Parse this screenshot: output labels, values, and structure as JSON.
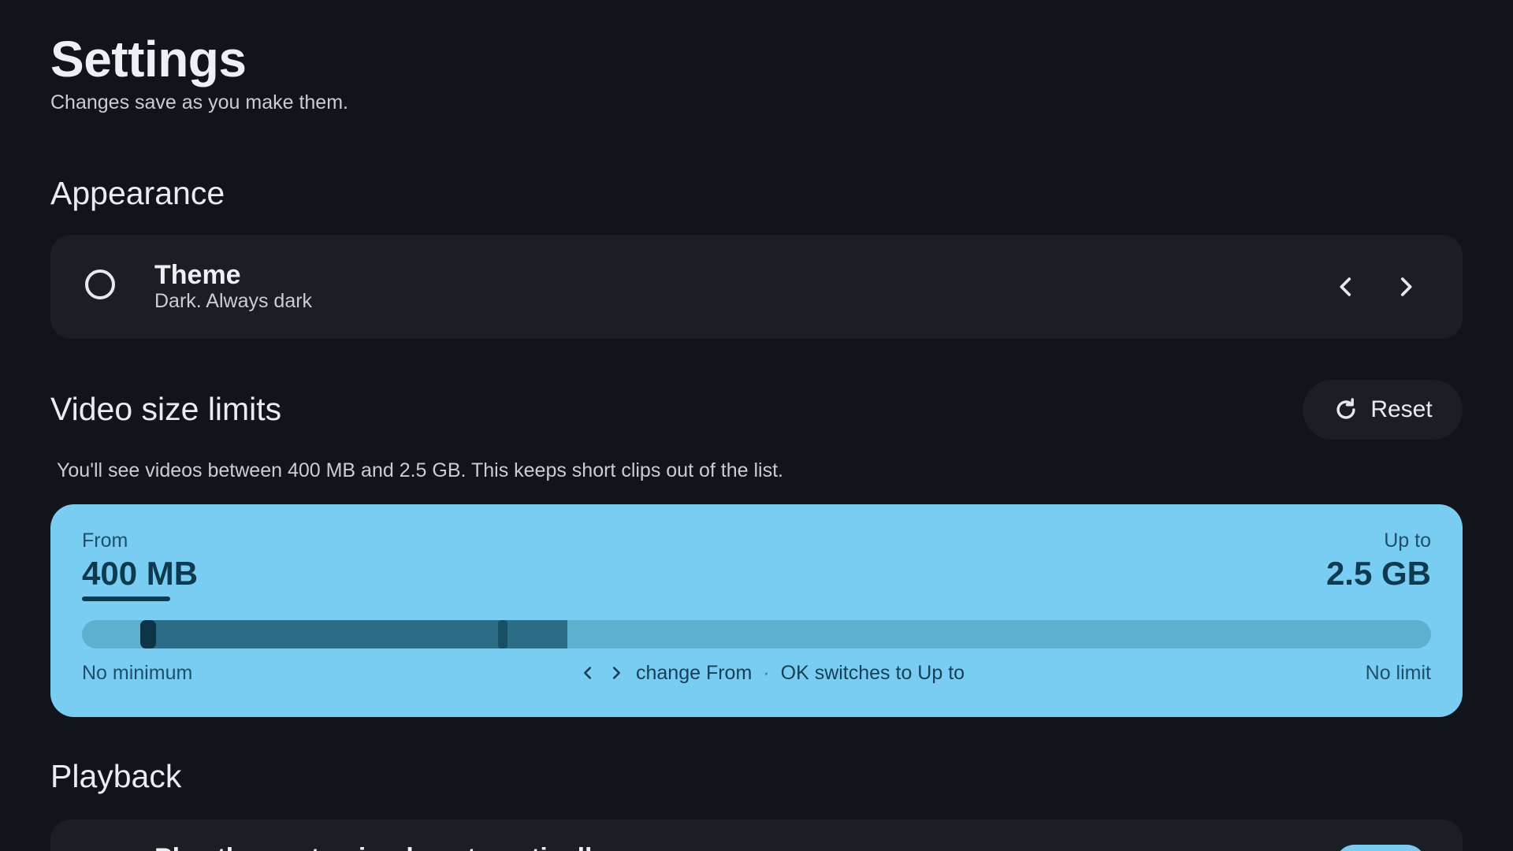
{
  "header": {
    "title": "Settings",
    "subtitle": "Changes save as you make them."
  },
  "appearance": {
    "section_title": "Appearance",
    "theme": {
      "title": "Theme",
      "value": "Dark. Always dark",
      "radio_icon": "radio-unchecked-icon",
      "prev_icon": "chevron-left-icon",
      "next_icon": "chevron-right-icon"
    }
  },
  "video_size": {
    "section_title": "Video size limits",
    "reset_label": "Reset",
    "reset_icon": "refresh-icon",
    "description": "You'll see videos between 400 MB and 2.5 GB. This keeps short clips out of the list.",
    "from_label": "From",
    "from_value": "400 MB",
    "to_label": "Up to",
    "to_value": "2.5 GB",
    "min_label": "No minimum",
    "max_label": "No limit",
    "hint_change": "change From",
    "hint_separator": "·",
    "hint_ok": "OK switches to Up to",
    "accent_color": "#79cdf2"
  },
  "playback": {
    "section_title": "Playback",
    "first_row_text": "Play the next episode automatically"
  }
}
